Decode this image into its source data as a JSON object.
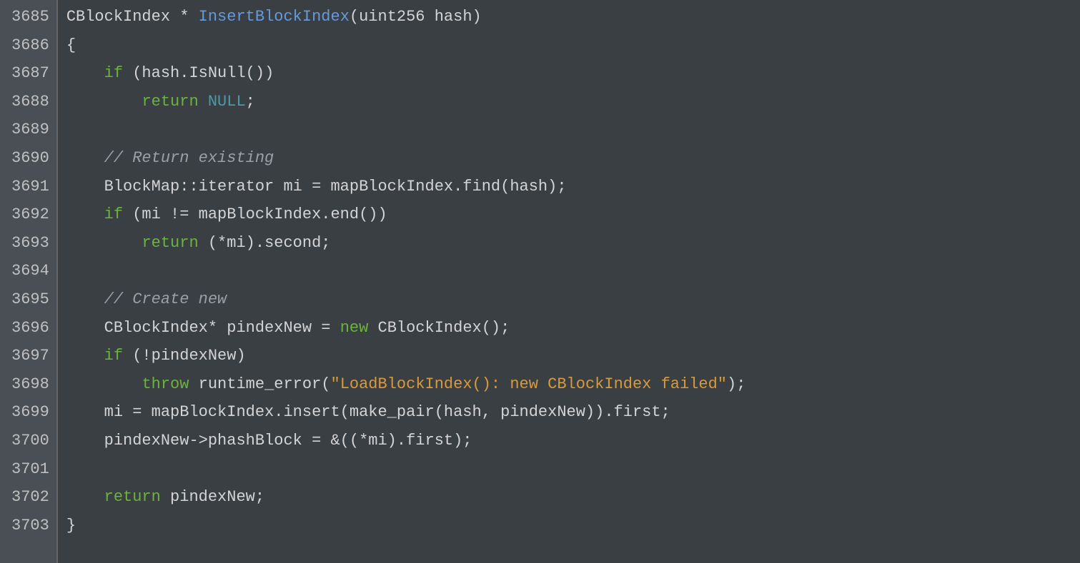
{
  "lines": [
    {
      "num": "3685",
      "tokens": [
        {
          "t": "CBlockIndex * ",
          "c": "ident"
        },
        {
          "t": "InsertBlockIndex",
          "c": "fn-name"
        },
        {
          "t": "(uint256 hash)",
          "c": "ident"
        }
      ]
    },
    {
      "num": "3686",
      "tokens": [
        {
          "t": "{",
          "c": "punct"
        }
      ]
    },
    {
      "num": "3687",
      "tokens": [
        {
          "t": "    ",
          "c": "ident"
        },
        {
          "t": "if",
          "c": "kw-ctrl"
        },
        {
          "t": " (hash.IsNull())",
          "c": "ident"
        }
      ]
    },
    {
      "num": "3688",
      "tokens": [
        {
          "t": "        ",
          "c": "ident"
        },
        {
          "t": "return",
          "c": "kw-return"
        },
        {
          "t": " ",
          "c": "ident"
        },
        {
          "t": "NULL",
          "c": "null-const"
        },
        {
          "t": ";",
          "c": "punct"
        }
      ]
    },
    {
      "num": "3689",
      "tokens": []
    },
    {
      "num": "3690",
      "tokens": [
        {
          "t": "    ",
          "c": "ident"
        },
        {
          "t": "// Return existing",
          "c": "comment"
        }
      ]
    },
    {
      "num": "3691",
      "tokens": [
        {
          "t": "    BlockMap::iterator mi = mapBlockIndex.find(hash);",
          "c": "ident"
        }
      ]
    },
    {
      "num": "3692",
      "tokens": [
        {
          "t": "    ",
          "c": "ident"
        },
        {
          "t": "if",
          "c": "kw-ctrl"
        },
        {
          "t": " (mi != mapBlockIndex.end())",
          "c": "ident"
        }
      ]
    },
    {
      "num": "3693",
      "tokens": [
        {
          "t": "        ",
          "c": "ident"
        },
        {
          "t": "return",
          "c": "kw-return"
        },
        {
          "t": " (*mi).second;",
          "c": "ident"
        }
      ]
    },
    {
      "num": "3694",
      "tokens": []
    },
    {
      "num": "3695",
      "tokens": [
        {
          "t": "    ",
          "c": "ident"
        },
        {
          "t": "// Create new",
          "c": "comment"
        }
      ]
    },
    {
      "num": "3696",
      "tokens": [
        {
          "t": "    CBlockIndex* pindexNew = ",
          "c": "ident"
        },
        {
          "t": "new",
          "c": "kw-new"
        },
        {
          "t": " CBlockIndex();",
          "c": "ident"
        }
      ]
    },
    {
      "num": "3697",
      "tokens": [
        {
          "t": "    ",
          "c": "ident"
        },
        {
          "t": "if",
          "c": "kw-ctrl"
        },
        {
          "t": " (!pindexNew)",
          "c": "ident"
        }
      ]
    },
    {
      "num": "3698",
      "tokens": [
        {
          "t": "        ",
          "c": "ident"
        },
        {
          "t": "throw",
          "c": "kw-throw"
        },
        {
          "t": " runtime_error(",
          "c": "ident"
        },
        {
          "t": "\"LoadBlockIndex(): new CBlockIndex failed\"",
          "c": "string"
        },
        {
          "t": ");",
          "c": "ident"
        }
      ]
    },
    {
      "num": "3699",
      "tokens": [
        {
          "t": "    mi = mapBlockIndex.insert(make_pair(hash, pindexNew)).first;",
          "c": "ident"
        }
      ]
    },
    {
      "num": "3700",
      "tokens": [
        {
          "t": "    pindexNew->phashBlock = &((*mi).first);",
          "c": "ident"
        }
      ]
    },
    {
      "num": "3701",
      "tokens": []
    },
    {
      "num": "3702",
      "tokens": [
        {
          "t": "    ",
          "c": "ident"
        },
        {
          "t": "return",
          "c": "kw-return"
        },
        {
          "t": " pindexNew;",
          "c": "ident"
        }
      ]
    },
    {
      "num": "3703",
      "tokens": [
        {
          "t": "}",
          "c": "punct"
        }
      ]
    }
  ]
}
